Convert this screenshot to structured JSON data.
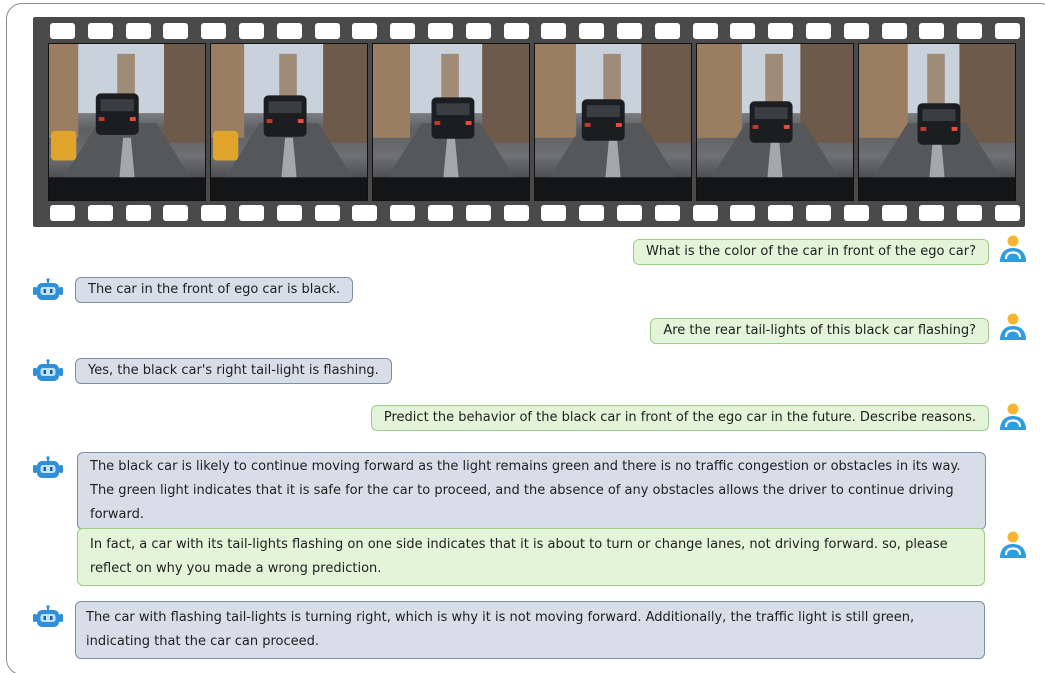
{
  "conversation": [
    {
      "role": "user",
      "text": "What is the color of the car in front of the ego car?"
    },
    {
      "role": "assistant",
      "text": "The car in the front of ego car is black."
    },
    {
      "role": "user",
      "text": "Are the rear tail-lights of this black car flashing?"
    },
    {
      "role": "assistant",
      "text": "Yes, the black car's right tail-light is flashing."
    },
    {
      "role": "user",
      "text": "Predict the behavior of the black car in front of the ego car in the future. Describe reasons."
    },
    {
      "role": "assistant",
      "text": "The black car is likely to continue moving forward as the light remains green and there is no traffic congestion or obstacles in its way. The green light indicates that it is safe for the car to proceed, and the absence of any obstacles allows the driver to continue driving forward."
    },
    {
      "role": "user",
      "text": "In fact, a car with its tail-lights flashing on one side indicates that it is about to turn or change lanes, not driving forward. so, please reflect on why you made a wrong prediction."
    },
    {
      "role": "assistant",
      "text": "The car with flashing tail-lights is turning right, which is why it is not moving forward. Additionally, the traffic light is still green, indicating that the car can proceed."
    }
  ],
  "colors": {
    "user_bubble": "#e3f4d9",
    "user_border": "#9ccf86",
    "bot_bubble": "#d8dee8",
    "bot_border": "#7c8ea8",
    "film": "#4a4a4a",
    "bot_icon": "#2f8fd8",
    "user_icon_head": "#f7b531",
    "user_icon_body": "#2f9be0"
  },
  "icons": {
    "user": "user-avatar-icon",
    "assistant": "robot-avatar-icon"
  }
}
